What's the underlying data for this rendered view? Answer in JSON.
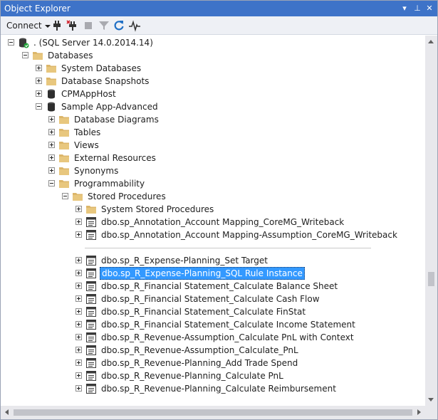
{
  "window": {
    "title": "Object Explorer",
    "buttons": {
      "dropdown": "▾",
      "pin": "⊥",
      "close": "✕"
    }
  },
  "toolbar": {
    "connect_label": "Connect",
    "tools": [
      "connect-icon",
      "disconnect-icon",
      "stop-icon",
      "filter-icon",
      "refresh-icon",
      "activity-monitor-icon"
    ]
  },
  "tree": {
    "server": ". (SQL Server 14.0.2014.14)",
    "databases": "Databases",
    "system_databases": "System Databases",
    "database_snapshots": "Database Snapshots",
    "cpmapphost": "CPMAppHost",
    "sample_app": "Sample App-Advanced",
    "database_diagrams": "Database Diagrams",
    "tables": "Tables",
    "views": "Views",
    "external_resources": "External Resources",
    "synonyms": "Synonyms",
    "programmability": "Programmability",
    "stored_procedures": "Stored Procedures",
    "system_stored_procedures": "System Stored Procedures",
    "procedures_top": [
      "dbo.sp_Annotation_Account Mapping_CoreMG_Writeback",
      "dbo.sp_Annotation_Account Mapping-Assumption_CoreMG_Writeback"
    ],
    "procedures": [
      "dbo.sp_R_Expense-Planning_Set Target",
      "dbo.sp_R_Expense-Planning_SQL Rule Instance",
      "dbo.sp_R_Financial Statement_Calculate Balance Sheet",
      "dbo.sp_R_Financial Statement_Calculate Cash Flow",
      "dbo.sp_R_Financial Statement_Calculate FinStat",
      "dbo.sp_R_Financial Statement_Calculate Income Statement",
      "dbo.sp_R_Revenue-Assumption_Calculate PnL with Context",
      "dbo.sp_R_Revenue-Assumption_Calculate_PnL",
      "dbo.sp_R_Revenue-Planning_Add Trade Spend",
      "dbo.sp_R_Revenue-Planning_Calculate PnL",
      "dbo.sp_R_Revenue-Planning_Calculate Reimbursement"
    ],
    "selected_procedure_index": 1
  },
  "colors": {
    "titlebar": "#3e73c8",
    "selection": "#3399ff",
    "folder": "#dcb66a"
  }
}
